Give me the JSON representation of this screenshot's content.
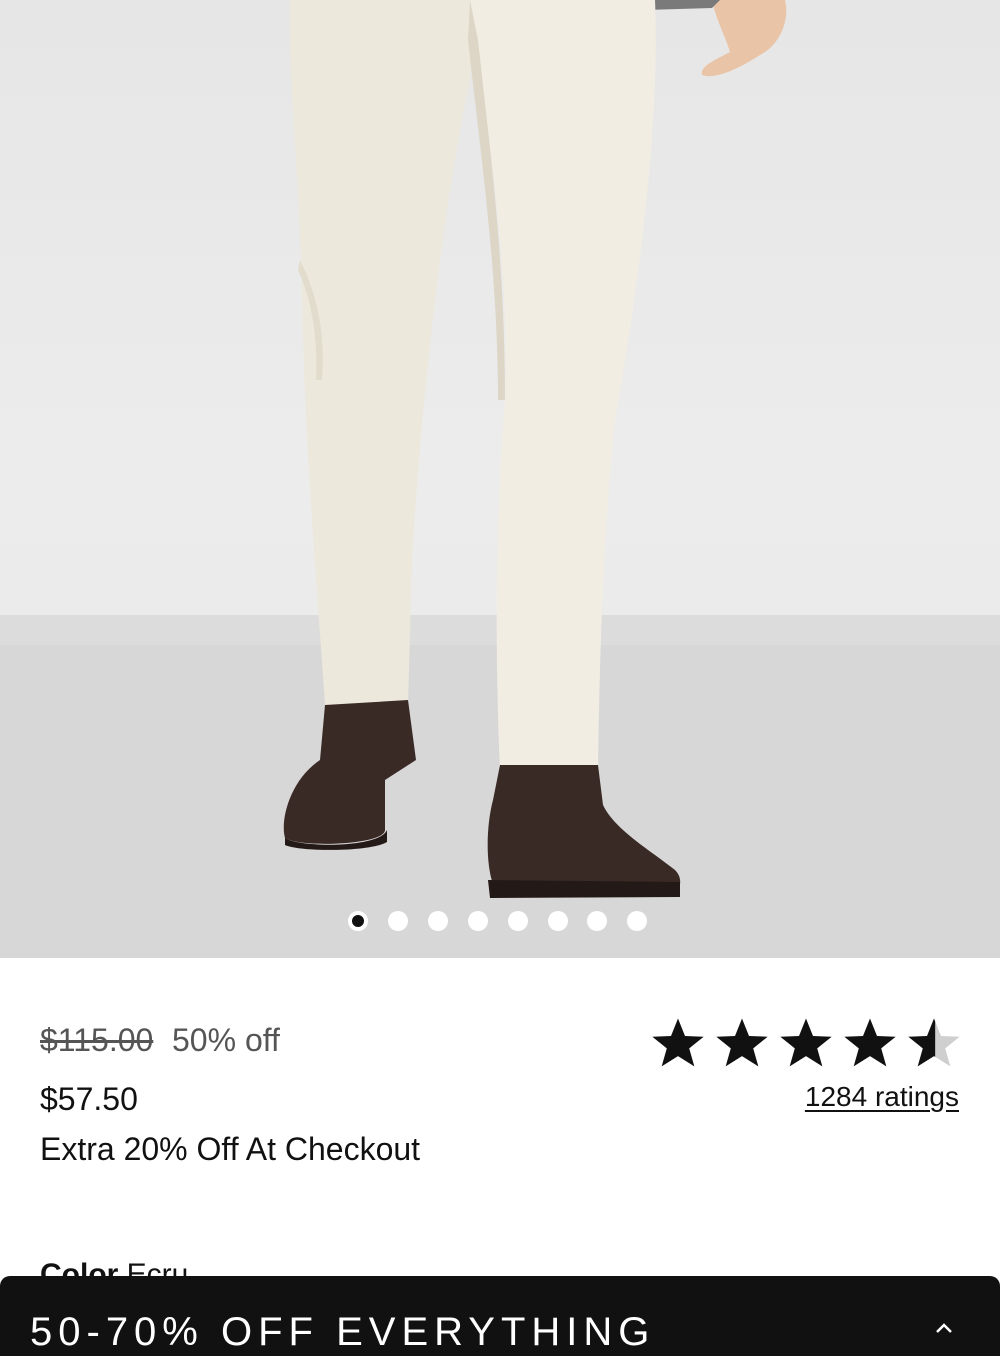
{
  "product_image": {
    "alt_icon": "product-photo",
    "carousel": {
      "total": 8,
      "active_index": 0
    }
  },
  "pricing": {
    "original_price": "$115.00",
    "discount": "50% off",
    "sale_price": "$57.50",
    "promo_text": "Extra 20% Off At Checkout"
  },
  "rating": {
    "stars_value": 4.5,
    "stars_max": 5,
    "ratings_link": "1284 ratings"
  },
  "color": {
    "label": "Color",
    "value": "Ecru"
  },
  "promo_banner": {
    "text": "50-70% OFF EVERYTHING",
    "icon": "chevron-up-icon"
  },
  "colors": {
    "banner_bg": "#111111",
    "star": "#111111",
    "pants": "#ede8dc",
    "boots": "#3a2a26"
  }
}
